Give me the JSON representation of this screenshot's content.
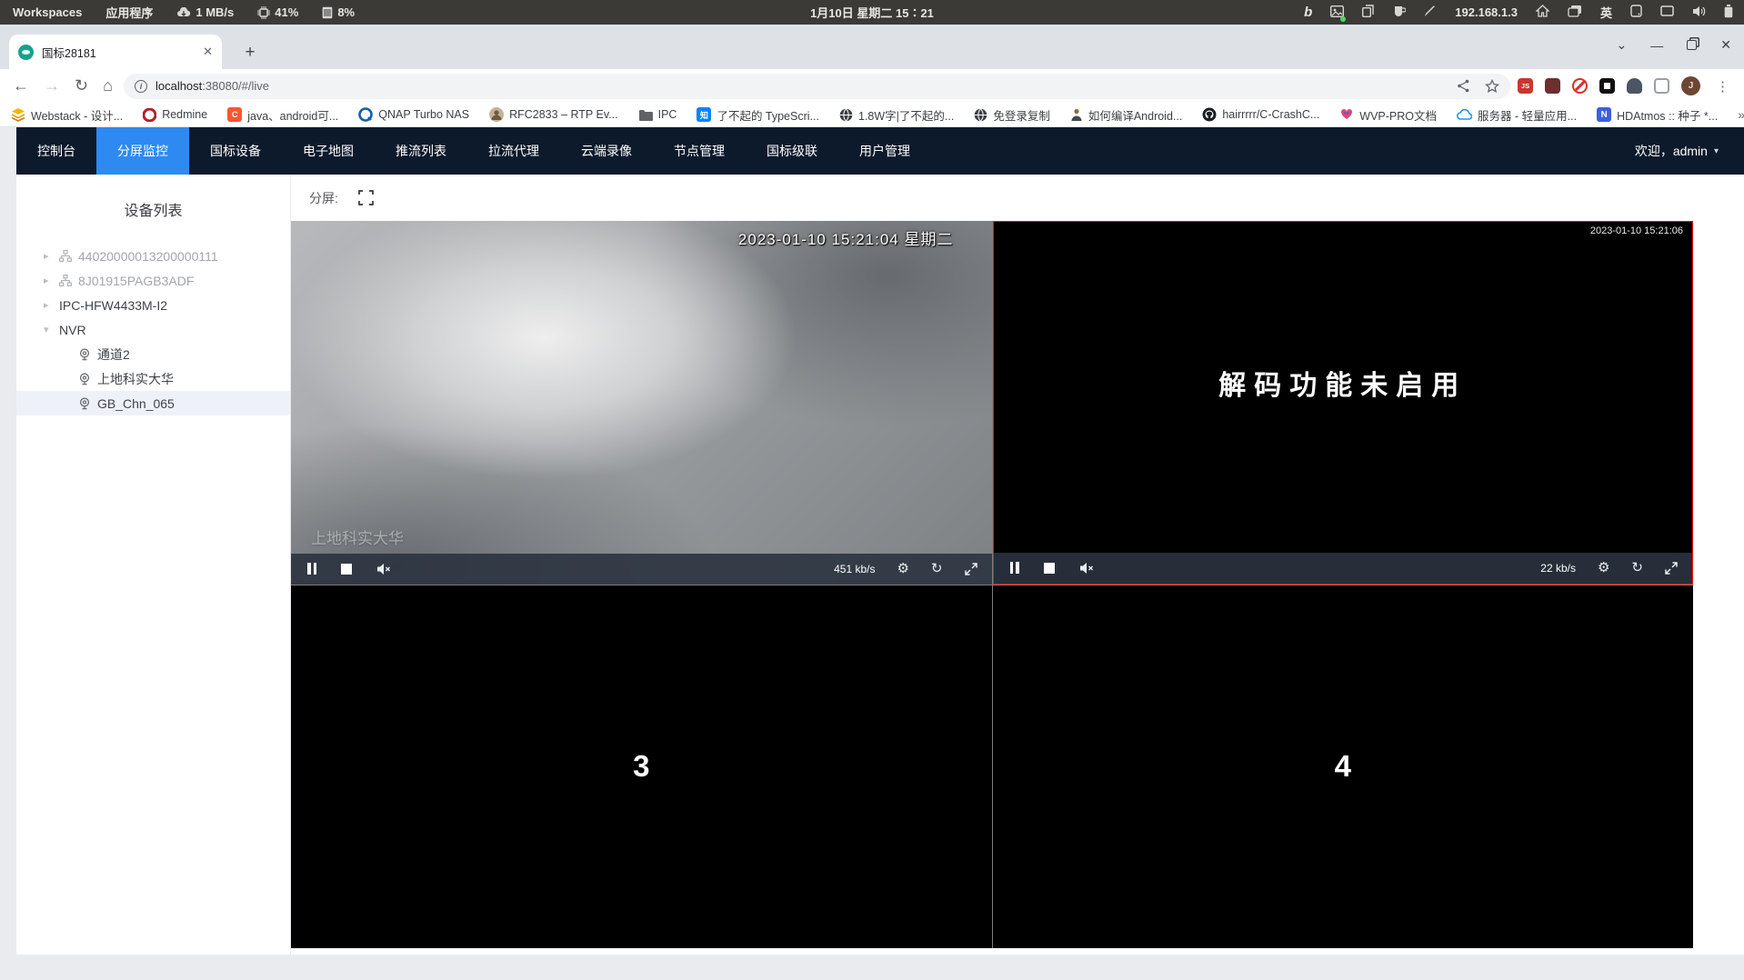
{
  "system_bar": {
    "workspaces": "Workspaces",
    "applications": "应用程序",
    "network_speed": "1 MB/s",
    "cpu_usage": "41%",
    "memory_usage": "8%",
    "clock": "1月10日 星期二 15∶21",
    "ip_address": "192.168.1.3",
    "input_method": "英"
  },
  "browser": {
    "tab_title": "国标28181",
    "new_tab_button": "+",
    "tab_close": "✕",
    "window_controls": {
      "tabs_chevron": "⌄",
      "minimize": "—",
      "close": "✕"
    },
    "back": "←",
    "forward": "→",
    "reload": "↻",
    "home": "⌂",
    "url_host": "localhost",
    "url_rest": ":38080/#/live",
    "ext_js_label": "JS",
    "menu_kebab": "⋮"
  },
  "bookmarks": {
    "items": [
      {
        "label": "Webstack - 设计..."
      },
      {
        "label": "Redmine"
      },
      {
        "label": "java、android可..."
      },
      {
        "label": "QNAP Turbo NAS"
      },
      {
        "label": "RFC2833 – RTP Ev..."
      },
      {
        "label": "IPC"
      },
      {
        "label": "了不起的 TypeScri..."
      },
      {
        "label": "1.8W字|了不起的..."
      },
      {
        "label": "免登录复制"
      },
      {
        "label": "如何编译Android..."
      },
      {
        "label": "hairrrrr/C-CrashC..."
      },
      {
        "label": "WVP-PRO文档"
      },
      {
        "label": "服务器 - 轻量应用..."
      },
      {
        "label": "HDAtmos :: 种子 *..."
      }
    ],
    "zhihu_glyph": "知",
    "csdn_glyph": "C",
    "n_glyph": "N",
    "overflow": "»"
  },
  "nav": {
    "items": [
      {
        "label": "控制台"
      },
      {
        "label": "分屏监控"
      },
      {
        "label": "国标设备"
      },
      {
        "label": "电子地图"
      },
      {
        "label": "推流列表"
      },
      {
        "label": "拉流代理"
      },
      {
        "label": "云端录像"
      },
      {
        "label": "节点管理"
      },
      {
        "label": "国标级联"
      },
      {
        "label": "用户管理"
      }
    ],
    "welcome": "欢迎，admin",
    "caret": "▾"
  },
  "sidebar": {
    "title": "设备列表",
    "caret_collapsed": "▸",
    "caret_expanded": "▾",
    "tree": [
      {
        "label": "44020000013200000111"
      },
      {
        "label": "8J01915PAGB3ADF"
      },
      {
        "label": "IPC-HFW4433M-I2"
      },
      {
        "label": "NVR",
        "children": [
          {
            "label": "通道2"
          },
          {
            "label": "上地科实大华"
          },
          {
            "label": "GB_Chn_065"
          }
        ]
      }
    ]
  },
  "toolbar": {
    "split_label": "分屏:"
  },
  "players": {
    "p1": {
      "osd": "2023-01-10 15:21:04 星期二",
      "watermark": "上地科实大华",
      "bitrate": "451 kb/s"
    },
    "p2": {
      "osd": "2023-01-10 15:21:06",
      "message": "解码功能未启用",
      "bitrate": "22 kb/s"
    },
    "p3": {
      "number": "3"
    },
    "p4": {
      "number": "4"
    },
    "gear": "⚙",
    "refresh": "↻"
  },
  "colors": {
    "accent": "#2e8af0",
    "nav_bg": "#0c1a2b",
    "selected_border": "#ff1100",
    "grid_icon_blue": "#3d8ef7"
  }
}
